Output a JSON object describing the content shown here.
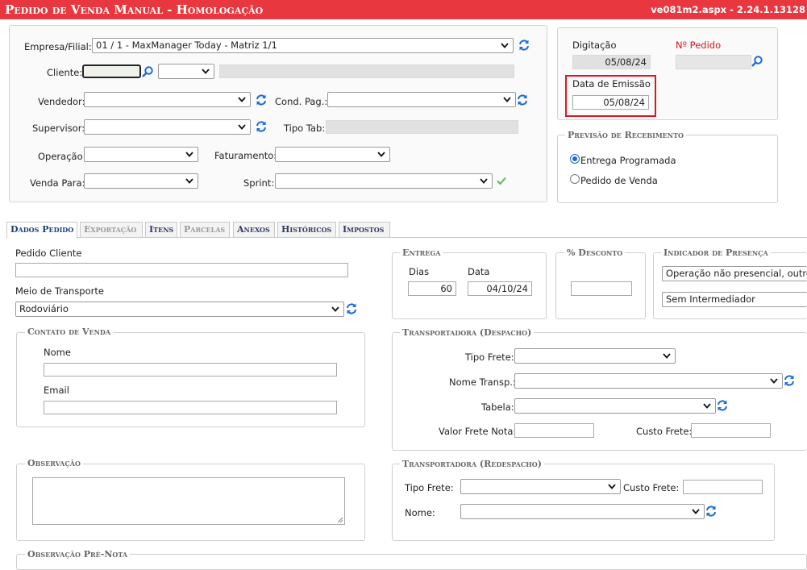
{
  "header": {
    "title": "Pedido de Venda Manual - Homologação",
    "version": "ve081m2.aspx - 2.24.1.13128"
  },
  "form": {
    "empresa_label": "Empresa/Filial:",
    "empresa_value": "01 / 1 - MaxManager Today - Matriz 1/1",
    "cliente_label": "Cliente:",
    "vendedor_label": "Vendedor:",
    "cond_pag_label": "Cond. Pag.:",
    "supervisor_label": "Supervisor:",
    "tipo_tab_label": "Tipo Tab:",
    "operacao_label": "Operação:",
    "faturamento_label": "Faturamento:",
    "venda_para_label": "Venda Para:",
    "sprint_label": "Sprint:"
  },
  "dates": {
    "digitacao_label": "Digitação",
    "digitacao_value": "05/08/24",
    "npedido_label": "Nº Pedido",
    "emissao_label": "Data de Emissão",
    "emissao_value": "05/08/24"
  },
  "previsao": {
    "title": "Previsão de Recebimento",
    "option1": "Entrega Programada",
    "option2": "Pedido de Venda"
  },
  "tabs": [
    "Dados Pedido",
    "Exportação",
    "Itens",
    "Parcelas",
    "Anexos",
    "Históricos",
    "Impostos"
  ],
  "dados": {
    "pedido_cliente_label": "Pedido Cliente",
    "meio_transporte_label": "Meio de Transporte",
    "meio_transporte_value": "Rodoviário",
    "contato_title": "Contato de Venda",
    "nome_label": "Nome",
    "email_label": "Email",
    "observacao_title": "Observação",
    "obs_pre_nota_title": "Observação Pré-Nota"
  },
  "entrega": {
    "title": "Entrega",
    "dias_label": "Dias",
    "dias_value": "60",
    "data_label": "Data",
    "data_value": "04/10/24"
  },
  "desconto": {
    "title": "% Desconto"
  },
  "presenca": {
    "title": "Indicador de Presença",
    "value1": "Operação não presencial, outros",
    "value2": "Sem Intermediador"
  },
  "despacho": {
    "title": "Transportadora (Despacho)",
    "tipo_frete_label": "Tipo Frete:",
    "nome_transp_label": "Nome Transp.:",
    "tabela_label": "Tabela:",
    "valor_frete_label": "Valor Frete Nota:",
    "custo_frete_label": "Custo Frete:"
  },
  "redespacho": {
    "title": "Transportadora (Redespacho)",
    "tipo_frete_label": "Tipo Frete:",
    "custo_frete_label": "Custo Frete:",
    "nome_label": "Nome:"
  },
  "colors": {
    "title_bar": "#e8373f",
    "highlight": "#e0161e",
    "npedido": "#d9141c",
    "icon_blue": "#1b6ad6",
    "check_green": "#5cb85c"
  }
}
